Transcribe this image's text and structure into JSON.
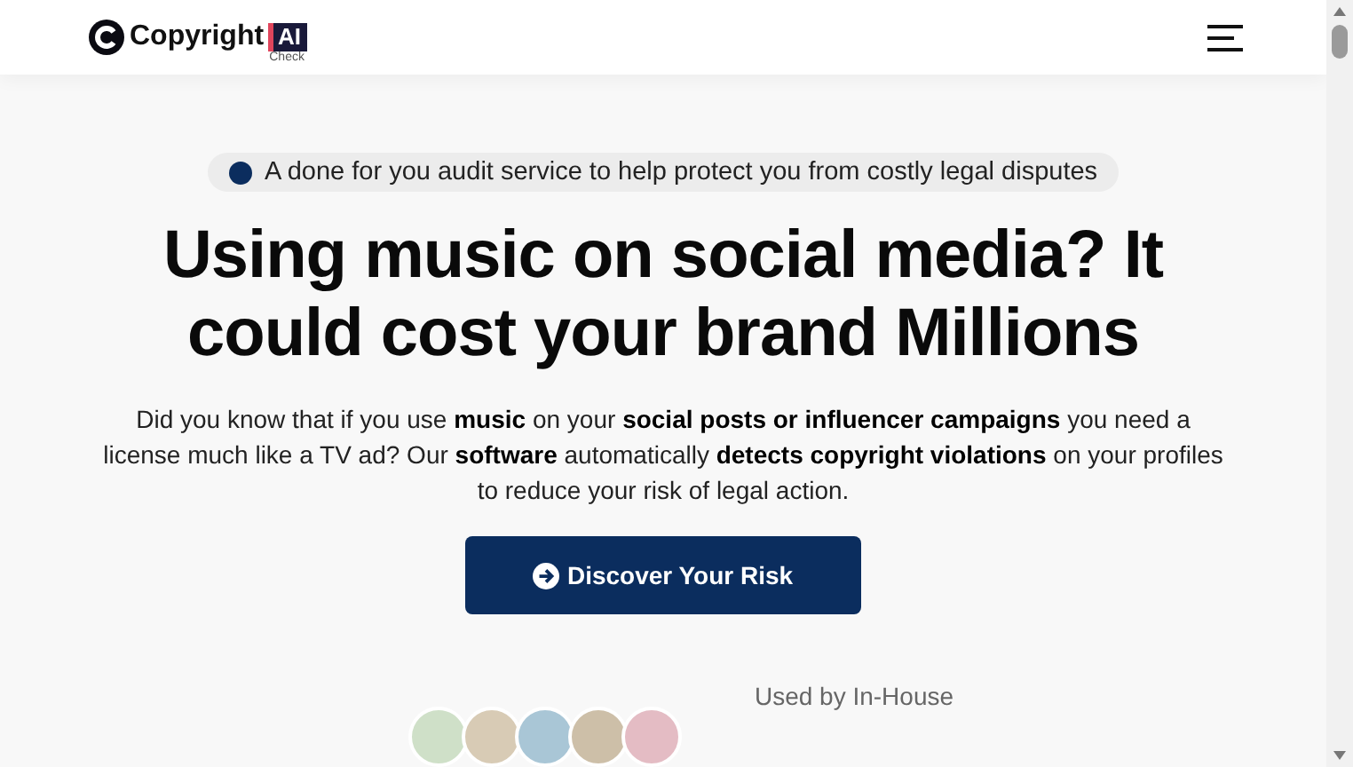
{
  "header": {
    "logo_text": "Copyright",
    "logo_badge": "AI",
    "logo_sub": "Check"
  },
  "hero": {
    "tagline": "A done for you audit service to help protect you from costly legal disputes",
    "title": "Using music on social media? It could cost your brand Millions",
    "description": "Did you know that if you use **music** on your **social posts or influencer campaigns** you need a license much like a TV ad? Our **software** automatically **detects copyright violations** on your profiles to reduce your risk of legal action.",
    "cta": "Discover Your Risk",
    "used_by": "Used by In-House"
  }
}
